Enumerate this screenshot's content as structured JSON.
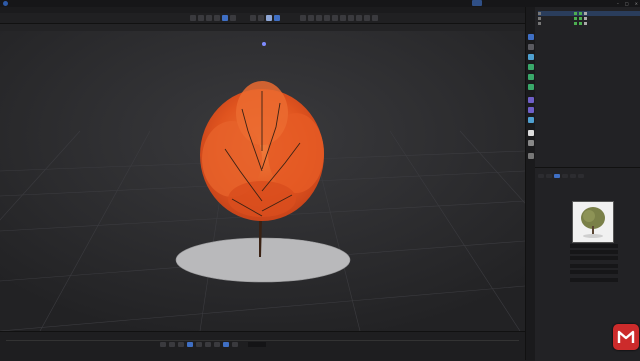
{
  "window": {
    "title": ""
  },
  "layout_tabs": [
    {
      "label": "",
      "active": true
    },
    {
      "label": "",
      "active": false
    },
    {
      "label": "",
      "active": false
    },
    {
      "label": "",
      "active": false
    },
    {
      "label": "",
      "active": false
    },
    {
      "label": "",
      "active": false
    },
    {
      "label": "",
      "active": false
    },
    {
      "label": "",
      "active": false
    }
  ],
  "menu": [],
  "viewport": {
    "camera_label": "",
    "menu": []
  },
  "timeline": {
    "frame": ""
  },
  "object_manager": {
    "tabs": [
      "",
      ""
    ],
    "objects": [
      {
        "name": "",
        "selected": true
      },
      {
        "name": "",
        "selected": false
      },
      {
        "name": "",
        "selected": false
      }
    ]
  },
  "attributes": {
    "tabs": [
      "",
      ""
    ],
    "object_title": "",
    "subtabs": [
      "",
      "",
      "",
      "",
      "",
      ""
    ],
    "fields": [
      {
        "label": "",
        "value": ""
      },
      {
        "label": "",
        "value": ""
      },
      {
        "label": "",
        "value": ""
      },
      {
        "label": "",
        "value": ""
      },
      {
        "label": "",
        "value": ""
      },
      {
        "label": "",
        "value": ""
      }
    ]
  },
  "colors": {
    "accent": "#3f6fc4",
    "foliage": "#e0541f",
    "watermark": "#cc2b2b"
  }
}
